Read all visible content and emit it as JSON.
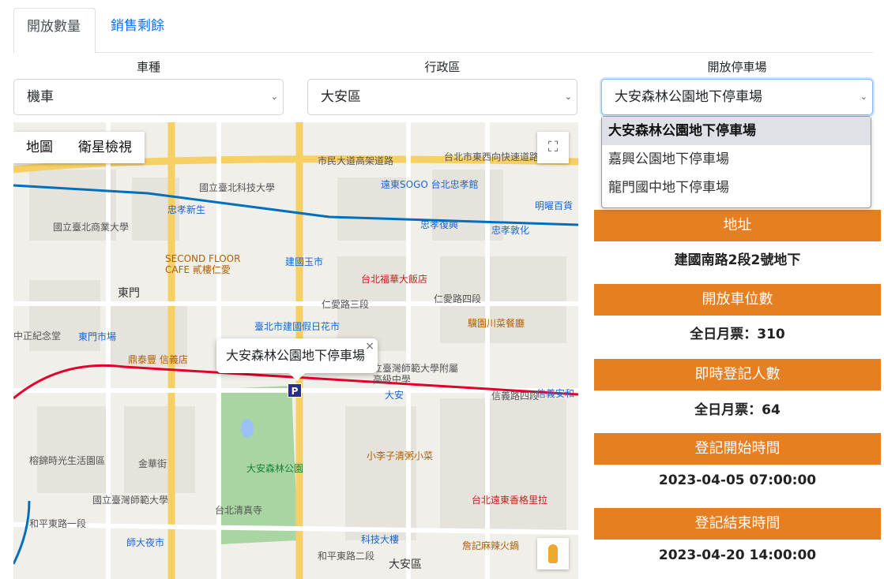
{
  "tabs": [
    {
      "label": "開放數量"
    },
    {
      "label": "銷售剩餘"
    }
  ],
  "filters": {
    "vehicle": {
      "label": "車種",
      "value": "機車"
    },
    "district": {
      "label": "行政區",
      "value": "大安區"
    },
    "lot": {
      "label": "開放停車場",
      "value": "大安森林公園地下停車場",
      "options": [
        "大安森林公園地下停車場",
        "嘉興公園地下停車場",
        "龍門國中地下停車場"
      ]
    }
  },
  "map": {
    "type_buttons": [
      "地圖",
      "衛星檢視"
    ],
    "info_title": "大安森林公園地下停車場",
    "info_close": "×",
    "marker_label": "P",
    "labels": [
      "市民大道高架道路",
      "台北市東西向快速道路",
      "國立臺北科技大學",
      "遠東SOGO 台北忠孝館",
      "明曜百貨",
      "忠孝新生",
      "忠孝復興",
      "忠孝敦化",
      "國立臺北商業大學",
      "SECOND FLOOR CAFE 貳樓仁愛",
      "建國玉市",
      "台北福華大飯店",
      "東門",
      "仁愛路三段",
      "仁愛路四段",
      "臺北市建國假日花市",
      "驥園川菜餐廳",
      "東門市場",
      "鼎泰豐 信義店",
      "大安森林公園",
      "立臺灣師範大學附屬高級中學",
      "大安",
      "信義路四段",
      "信義安和",
      "榕錦時光生活園區",
      "金華街",
      "小李子清粥小菜",
      "國立臺灣師範大學",
      "台北清真寺",
      "台北遠東香格里拉",
      "和平東路一段",
      "師大夜市",
      "科技大樓",
      "和平東路二段",
      "詹記麻辣火鍋",
      "大安區",
      "中正紀念堂"
    ]
  },
  "info": [
    {
      "header": "地址",
      "value": "建國南路2段2號地下"
    },
    {
      "header": "開放車位數",
      "value": "全日月票：310"
    },
    {
      "header": "即時登記人數",
      "value": "全日月票：64"
    },
    {
      "header": "登記開始時間",
      "value": "2023-04-05 07:00:00"
    },
    {
      "header": "登記結束時間",
      "value": "2023-04-20 14:00:00"
    }
  ],
  "colors": {
    "accent": "#e67e22",
    "link": "#0d6efd",
    "park": "#a8d5a2",
    "road_major": "#f6cf65",
    "metro_blue": "#0070bd",
    "metro_red": "#e3002c"
  }
}
